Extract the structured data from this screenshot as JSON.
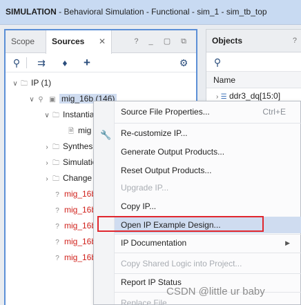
{
  "title_bar": {
    "mode": "SIMULATION",
    "context": " - Behavioral Simulation - Functional - sim_1 - sim_tb_top"
  },
  "left_pane": {
    "tabs": [
      {
        "label": "Scope"
      },
      {
        "label": "Sources"
      }
    ],
    "tab_close": "✕",
    "window_controls": "? _ ▢ ⧉",
    "toolbar_icons": [
      "search-icon",
      "collapse-all-icon",
      "expand-all-icon",
      "add-icon",
      "gear-icon"
    ],
    "tree": {
      "root": "IP (1)",
      "ip_core": "mig_16b (146)",
      "instantiation": "Instantiati",
      "mig_item": "mig",
      "synthesis": "Synthes",
      "simulation": "Simulatio",
      "change": "Change",
      "red_files": [
        "mig_16b",
        "mig_16b",
        "mig_16b",
        "mig_16b",
        "mig_16b"
      ]
    }
  },
  "right_pane": {
    "tab": "Objects",
    "help": "?",
    "column": "Name",
    "row1": "ddr3_dq[15:0]"
  },
  "context_menu": {
    "items": [
      {
        "label": "Source File Properties...",
        "accel": "Ctrl+E",
        "enabled": true
      },
      {
        "label": "Re-customize IP...",
        "enabled": true,
        "icon": "wrench-icon"
      },
      {
        "label": "Generate Output Products...",
        "enabled": true
      },
      {
        "label": "Reset Output Products...",
        "enabled": true
      },
      {
        "label": "Upgrade IP...",
        "enabled": false
      },
      {
        "label": "Copy IP...",
        "enabled": true
      },
      {
        "label": "Open IP Example Design...",
        "enabled": true,
        "highlighted": true
      },
      {
        "label": "IP Documentation",
        "enabled": true,
        "submenu": "▶"
      },
      {
        "label": "Copy Shared Logic into Project...",
        "enabled": false
      },
      {
        "label": "Report IP Status",
        "enabled": true
      },
      {
        "label": "Replace File",
        "enabled": false
      }
    ],
    "highlight_box_color": "#e0262d"
  },
  "watermark": "CSDN @little ur baby",
  "colors": {
    "title_bg": "#c8daf2",
    "active_pane_border": "#5b8fd6",
    "selection": "#cfdcf0",
    "error_red": "#d0201a"
  }
}
